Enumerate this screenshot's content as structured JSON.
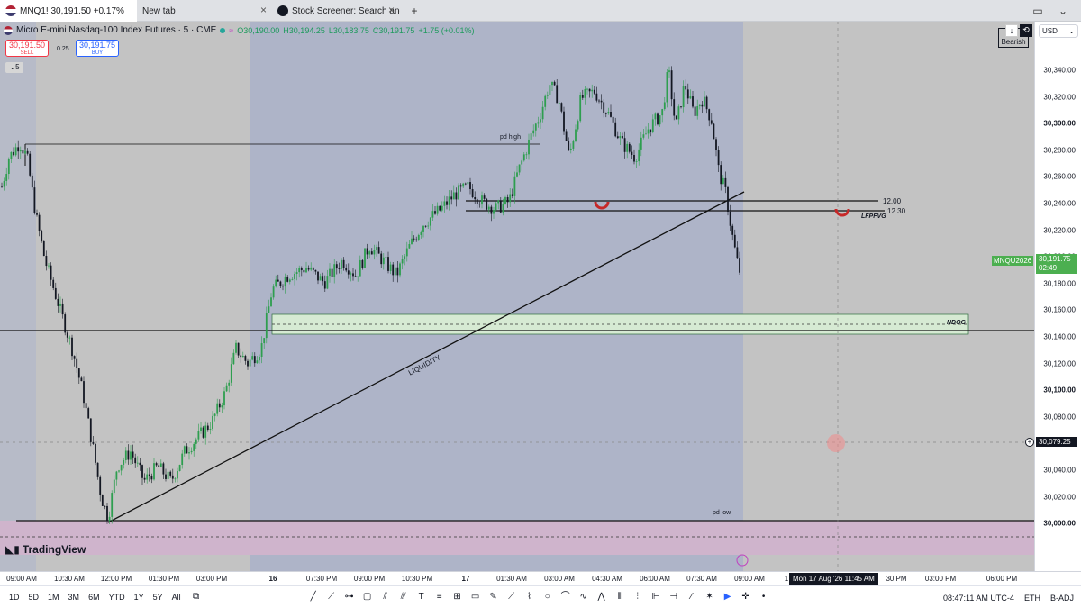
{
  "browser": {
    "tabs": [
      {
        "title": "MNQ1! 30,191.50 +0.17%",
        "active": true
      },
      {
        "title": "New tab",
        "active": false
      },
      {
        "title": "Stock Screener: Search and",
        "active": false
      }
    ],
    "new_tab_symbol": "+"
  },
  "symbol": {
    "name": "Micro E-mini Nasdaq-100 Index Futures · 5 · CME",
    "ohlc": {
      "o": "O30,190.00",
      "h": "H30,194.25",
      "l": "L30,183.75",
      "c": "C30,191.75",
      "chg": "+1.75 (+0.01%)"
    },
    "sell_price": "30,191.50",
    "sell_label": "SELL",
    "spread": "0.25",
    "buy_price": "30,191.75",
    "buy_label": "BUY",
    "indicator_count": "5"
  },
  "top_right": {
    "bias_label": "Bearish",
    "bias_prefix": "N",
    "currency": "USD"
  },
  "price_axis": {
    "ticks": [
      "30,340.00",
      "30,320.00",
      "30,300.00",
      "30,280.00",
      "30,260.00",
      "30,240.00",
      "30,220.00",
      "30,200.00",
      "30,180.00",
      "30,160.00",
      "30,140.00",
      "30,120.00",
      "30,100.00",
      "30,080.00",
      "30,060.00",
      "30,040.00",
      "30,020.00",
      "30,000.00"
    ],
    "bold_ticks": [
      "30,300.00",
      "30,200.00",
      "30,100.00",
      "30,000.00"
    ],
    "current_symbol": "MNQU2026",
    "current_price": "30,191.75",
    "countdown": "02:49",
    "crosshair_price": "30,079.25"
  },
  "time_axis": {
    "ticks": [
      "09:00 AM",
      "10:30 AM",
      "12:00 PM",
      "01:30 PM",
      "03:00 PM",
      "16",
      "07:30 PM",
      "09:00 PM",
      "10:30 PM",
      "17",
      "01:30 AM",
      "03:00 AM",
      "04:30 AM",
      "06:00 AM",
      "07:30 AM",
      "09:00 AM",
      "1",
      "30 PM",
      "03:00 PM",
      "06:00 PM"
    ],
    "crosshair_time": "Mon 17 Aug '26   11:45 AM"
  },
  "annotations": {
    "pd_high": "pd high",
    "pd_low": "pd low",
    "liquidity": "LIQUIDITY",
    "level_1": "12.00",
    "level_2": "12.30",
    "lfpfvg": "LFPFVG",
    "ndog": "NDOG"
  },
  "brand": "TradingView",
  "bottom": {
    "timeframes": [
      "1D",
      "5D",
      "1M",
      "3M",
      "6M",
      "YTD",
      "1Y",
      "5Y",
      "All"
    ],
    "clock": "08:47:11 AM UTC-4",
    "session": "ETH",
    "adj": "B-ADJ"
  },
  "colors": {
    "up": "#2e9e4f",
    "down": "#131722",
    "bg": "#c3c3c3",
    "session_shade": "#aeb4c8",
    "fvg": "#d6ead3",
    "low_zone": "#cfb4cc",
    "sell": "#f23645",
    "buy": "#2962ff",
    "price_label": "#4caf50"
  },
  "chart_data": {
    "type": "candlestick",
    "yrange": [
      29995,
      30350
    ],
    "key_levels": {
      "pd_high": 30287,
      "pd_low": 30023,
      "ndog": 30161,
      "level_1200": 30247,
      "level_1230": 30240,
      "horizontal": 30157
    }
  }
}
